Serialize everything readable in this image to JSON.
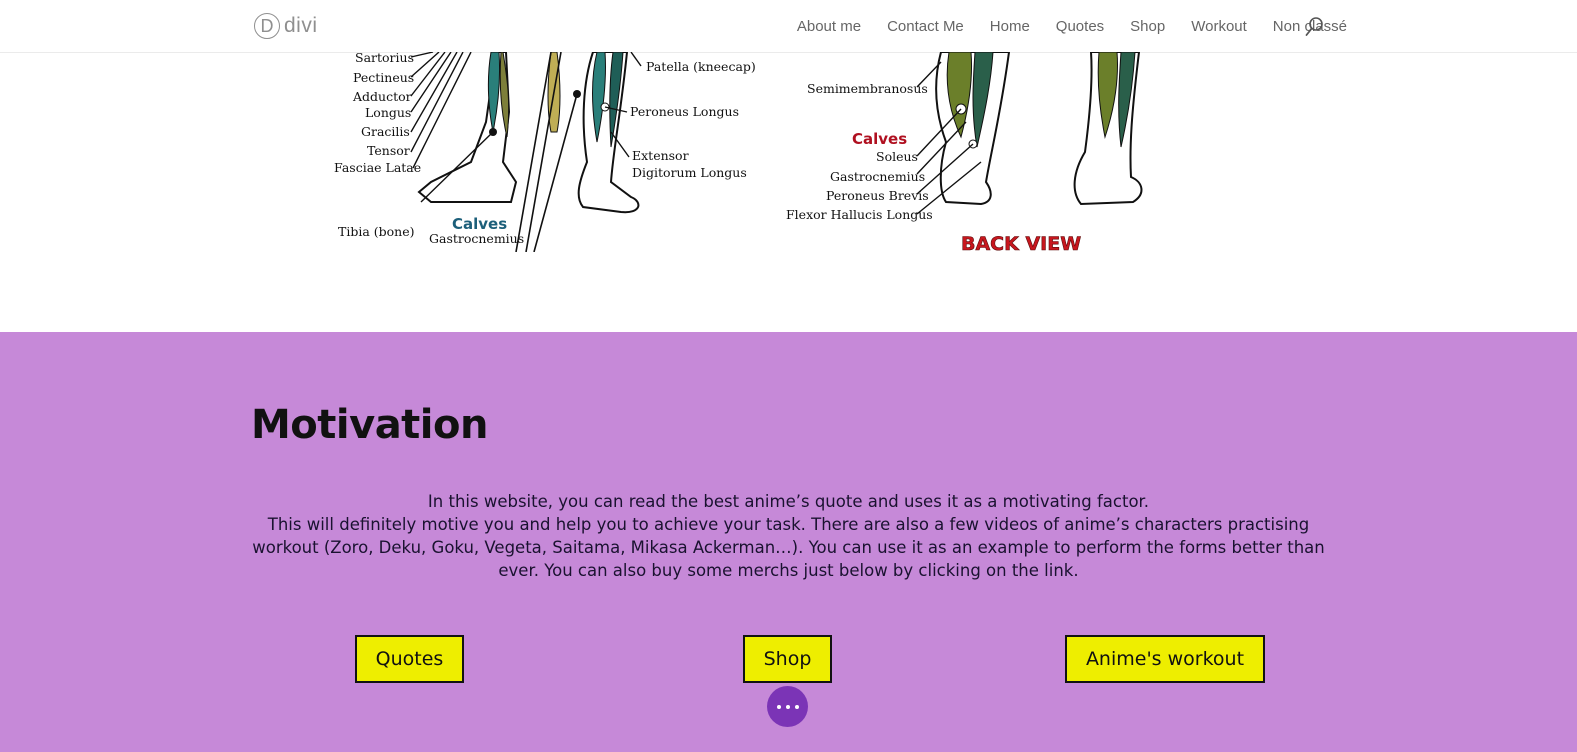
{
  "header": {
    "logo_letter": "D",
    "logo_text": "divi",
    "nav": [
      {
        "label": "About me"
      },
      {
        "label": "Contact Me"
      },
      {
        "label": "Home"
      },
      {
        "label": "Quotes"
      },
      {
        "label": "Shop"
      },
      {
        "label": "Workout"
      },
      {
        "label": "Non classé"
      }
    ],
    "search_icon": "search-icon"
  },
  "anatomy": {
    "front_labels": [
      "Sartorius",
      "Pectineus",
      "Adductor",
      "Longus",
      "Gracilis",
      "Tensor",
      "Fasciae Latae",
      "Tibia (bone)",
      "Calves",
      "Gastrocnemius",
      "Patella (kneecap)",
      "Peroneus Longus",
      "Extensor",
      "Digitorum Longus"
    ],
    "back_labels": [
      "Semimembranosus",
      "Calves",
      "Soleus",
      "Gastrocnemius",
      "Peroneus Brevis",
      "Flexor Hallucis Longus",
      "BACK VIEW"
    ]
  },
  "motivation": {
    "title": "Motivation",
    "paragraph_line1": "In this website, you can read the best anime’s quote and uses it as a motivating factor.",
    "paragraph_rest": "This will definitely motive you and help you to achieve your task. There are also a few videos of anime’s characters practising workout (Zoro, Deku, Goku, Vegeta, Saitama, Mikasa Ackerman…). You can use it as an example to perform the forms better than ever. You can also buy some merchs just below by clicking on the link.",
    "buttons": {
      "quotes": "Quotes",
      "shop": "Shop",
      "workout": "Anime's workout"
    },
    "fab_icon": "more-dots-icon"
  },
  "colors": {
    "section_bg": "#c689d8",
    "button_bg": "#eeee00",
    "fab_bg": "#7b34b6",
    "calves_front": "#1c5f7a",
    "calves_back": "#b01020"
  }
}
